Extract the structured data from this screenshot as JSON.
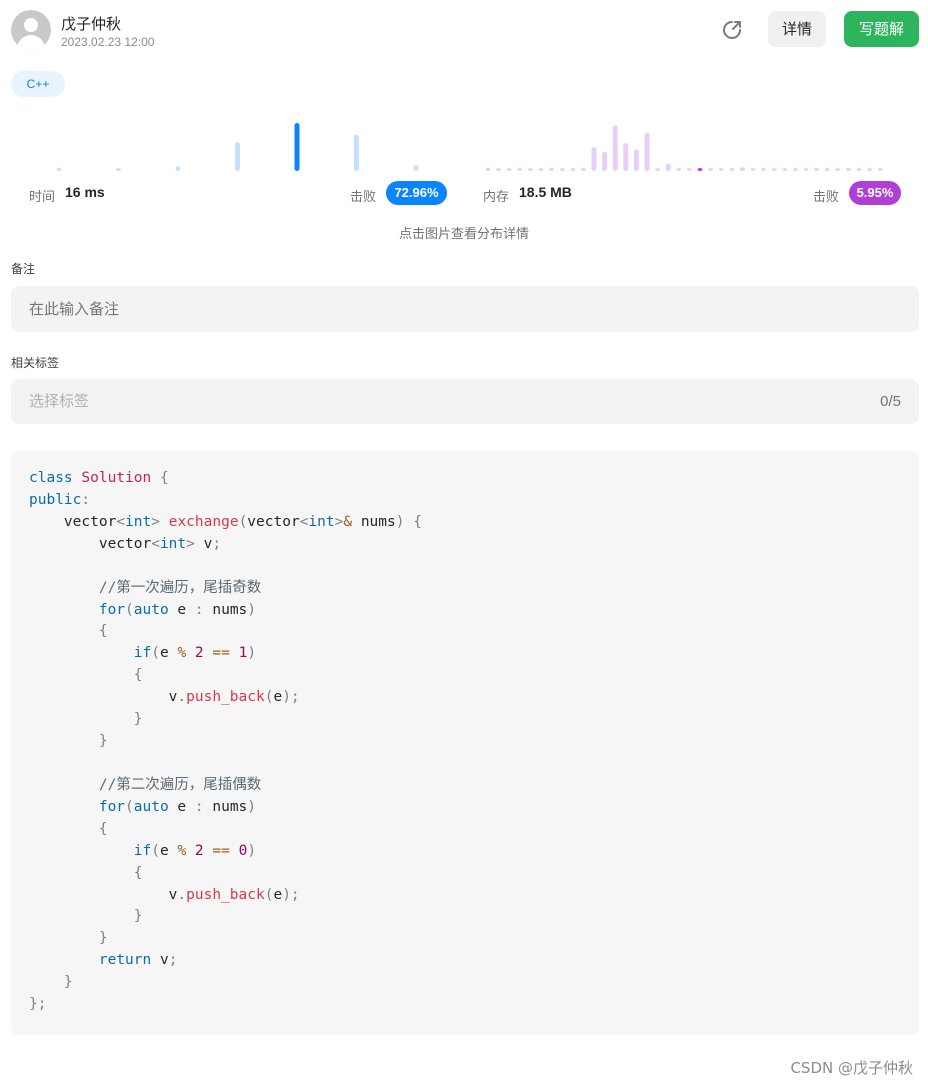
{
  "header": {
    "username": "戊子仲秋",
    "datetime": "2023.02.23 12:00",
    "detail_button": "详情",
    "write_solution_button": "写题解",
    "share_icon": "share-icon"
  },
  "language_tag": "C++",
  "stats": {
    "time_label": "时间",
    "time_value": "16 ms",
    "time_beat_label": "击败",
    "time_beat_percent": "72.96%",
    "memory_label": "内存",
    "memory_value": "18.5 MB",
    "memory_beat_label": "击败",
    "memory_beat_percent": "5.95%",
    "hint": "点击图片查看分布详情",
    "colors": {
      "time_accent": "#0a84ff",
      "time_light": "#c3e0fc",
      "memory_accent": "#b03fd6",
      "memory_light": "#e6d0f5"
    },
    "time_distribution": [
      0.05,
      0.05,
      0.1,
      0.6,
      1.0,
      0.76,
      0.12
    ],
    "time_highlight_index": 4,
    "memory_distribution": [
      0.04,
      0.04,
      0.04,
      0.04,
      0.04,
      0.04,
      0.04,
      0.04,
      0.04,
      0.04,
      0.5,
      0.4,
      0.95,
      0.58,
      0.45,
      0.8,
      0.04,
      0.15,
      0.04,
      0.04,
      0.04,
      0.04,
      0.04,
      0.04,
      0.08,
      0.04,
      0.04,
      0.04,
      0.04,
      0.04,
      0.04,
      0.04,
      0.04,
      0.04,
      0.04,
      0.04,
      0.04,
      0.04
    ],
    "memory_highlight_index": 20
  },
  "note": {
    "label": "备注",
    "placeholder": "在此输入备注"
  },
  "tags": {
    "label": "相关标签",
    "placeholder": "选择标签",
    "count": "0/5"
  },
  "code": {
    "lines": [
      [
        [
          "kw",
          "class"
        ],
        [
          "id",
          " "
        ],
        [
          "cls",
          "Solution"
        ],
        [
          "id",
          " "
        ],
        [
          "punc",
          "{"
        ]
      ],
      [
        [
          "kw",
          "public"
        ],
        [
          "punc",
          ":"
        ]
      ],
      [
        [
          "id",
          "    vector"
        ],
        [
          "punc",
          "<"
        ],
        [
          "type",
          "int"
        ],
        [
          "punc",
          "> "
        ],
        [
          "fn",
          "exchange"
        ],
        [
          "punc",
          "("
        ],
        [
          "id",
          "vector"
        ],
        [
          "punc",
          "<"
        ],
        [
          "type",
          "int"
        ],
        [
          "punc",
          ">"
        ],
        [
          "op",
          "&"
        ],
        [
          "id",
          " nums"
        ],
        [
          "punc",
          ") {"
        ]
      ],
      [
        [
          "id",
          "        vector"
        ],
        [
          "punc",
          "<"
        ],
        [
          "type",
          "int"
        ],
        [
          "punc",
          "> "
        ],
        [
          "id",
          "v"
        ],
        [
          "punc",
          ";"
        ]
      ],
      [],
      [
        [
          "cm",
          "        //第一次遍历，尾插奇数"
        ]
      ],
      [
        [
          "id",
          "        "
        ],
        [
          "kw",
          "for"
        ],
        [
          "punc",
          "("
        ],
        [
          "kw",
          "auto"
        ],
        [
          "id",
          " e "
        ],
        [
          "punc",
          ":"
        ],
        [
          "id",
          " nums"
        ],
        [
          "punc",
          ")"
        ]
      ],
      [
        [
          "punc",
          "        {"
        ]
      ],
      [
        [
          "id",
          "            "
        ],
        [
          "kw",
          "if"
        ],
        [
          "punc",
          "("
        ],
        [
          "id",
          "e "
        ],
        [
          "op",
          "%"
        ],
        [
          "id",
          " "
        ],
        [
          "num",
          "2"
        ],
        [
          "id",
          " "
        ],
        [
          "op",
          "=="
        ],
        [
          "id",
          " "
        ],
        [
          "num",
          "1"
        ],
        [
          "punc",
          ")"
        ]
      ],
      [
        [
          "punc",
          "            {"
        ]
      ],
      [
        [
          "id",
          "                v"
        ],
        [
          "punc",
          "."
        ],
        [
          "fn",
          "push_back"
        ],
        [
          "punc",
          "("
        ],
        [
          "id",
          "e"
        ],
        [
          "punc",
          ");"
        ]
      ],
      [
        [
          "punc",
          "            }"
        ]
      ],
      [
        [
          "punc",
          "        }"
        ]
      ],
      [],
      [
        [
          "cm",
          "        //第二次遍历，尾插偶数"
        ]
      ],
      [
        [
          "id",
          "        "
        ],
        [
          "kw",
          "for"
        ],
        [
          "punc",
          "("
        ],
        [
          "kw",
          "auto"
        ],
        [
          "id",
          " e "
        ],
        [
          "punc",
          ":"
        ],
        [
          "id",
          " nums"
        ],
        [
          "punc",
          ")"
        ]
      ],
      [
        [
          "punc",
          "        {"
        ]
      ],
      [
        [
          "id",
          "            "
        ],
        [
          "kw",
          "if"
        ],
        [
          "punc",
          "("
        ],
        [
          "id",
          "e "
        ],
        [
          "op",
          "%"
        ],
        [
          "id",
          " "
        ],
        [
          "num",
          "2"
        ],
        [
          "id",
          " "
        ],
        [
          "op",
          "=="
        ],
        [
          "id",
          " "
        ],
        [
          "num",
          "0"
        ],
        [
          "punc",
          ")"
        ]
      ],
      [
        [
          "punc",
          "            {"
        ]
      ],
      [
        [
          "id",
          "                v"
        ],
        [
          "punc",
          "."
        ],
        [
          "fn",
          "push_back"
        ],
        [
          "punc",
          "("
        ],
        [
          "id",
          "e"
        ],
        [
          "punc",
          ");"
        ]
      ],
      [
        [
          "punc",
          "            }"
        ]
      ],
      [
        [
          "punc",
          "        }"
        ]
      ],
      [
        [
          "id",
          "        "
        ],
        [
          "kw",
          "return"
        ],
        [
          "id",
          " v"
        ],
        [
          "punc",
          ";"
        ]
      ],
      [
        [
          "punc",
          "    }"
        ]
      ],
      [
        [
          "punc",
          "};"
        ]
      ]
    ]
  },
  "watermark": "CSDN @戊子仲秋"
}
